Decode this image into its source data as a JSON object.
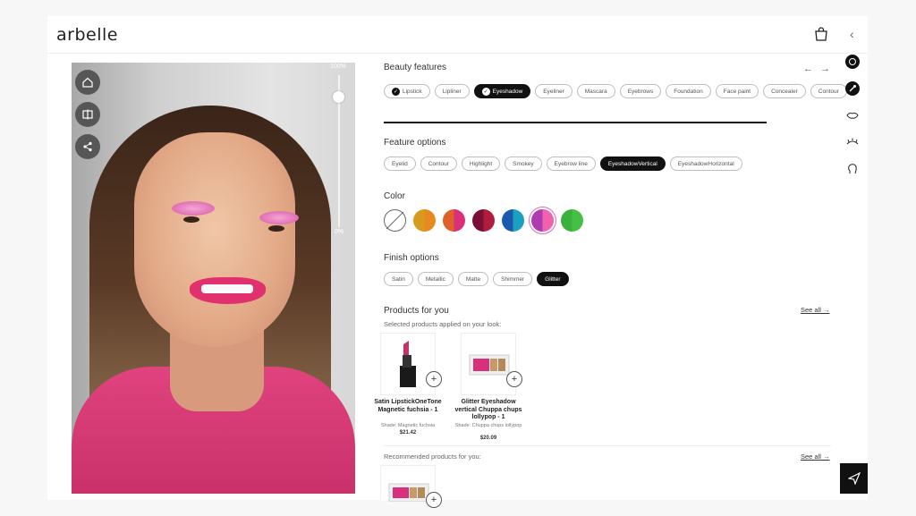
{
  "brand": {
    "logo": "arbelle"
  },
  "camera": {
    "slider_max_label": "100%",
    "slider_min_label": "0%",
    "intensity": 0.86,
    "buttons": [
      "home-icon",
      "compare-icon",
      "share-icon"
    ]
  },
  "beauty_features": {
    "title": "Beauty features",
    "items": [
      {
        "label": "Lipstick",
        "checked": true,
        "active": false
      },
      {
        "label": "Lipliner",
        "checked": false,
        "active": false
      },
      {
        "label": "Eyeshadow",
        "checked": true,
        "active": true
      },
      {
        "label": "Eyeliner",
        "checked": false,
        "active": false
      },
      {
        "label": "Mascara",
        "checked": false,
        "active": false
      },
      {
        "label": "Eyebrows",
        "checked": false,
        "active": false
      },
      {
        "label": "Foundation",
        "checked": false,
        "active": false
      },
      {
        "label": "Face paint",
        "checked": false,
        "active": false
      },
      {
        "label": "Concealer",
        "checked": false,
        "active": false
      },
      {
        "label": "Contour",
        "checked": false,
        "active": false
      }
    ]
  },
  "feature_options": {
    "title": "Feature options",
    "items": [
      {
        "label": "Eyelid",
        "active": false
      },
      {
        "label": "Contour",
        "active": false
      },
      {
        "label": "Highlight",
        "active": false
      },
      {
        "label": "Smokey",
        "active": false
      },
      {
        "label": "Eyebrow line",
        "active": false
      },
      {
        "label": "EyeshadowVertical",
        "active": true
      },
      {
        "label": "EyeshadowHorizontal",
        "active": false
      }
    ]
  },
  "color": {
    "title": "Color",
    "swatches": [
      {
        "name": "none",
        "left": "#ffffff",
        "right": "#ffffff"
      },
      {
        "name": "gold-orange",
        "left": "#d89a1e",
        "right": "#e68a20"
      },
      {
        "name": "orange-pink",
        "left": "#e0602a",
        "right": "#d8307a"
      },
      {
        "name": "plum-red",
        "left": "#7a1036",
        "right": "#b01c3c"
      },
      {
        "name": "blue-teal",
        "left": "#1c5ab0",
        "right": "#1ca0c0"
      },
      {
        "name": "magenta-pink",
        "left": "#b03ab0",
        "right": "#f062b0",
        "selected": true
      },
      {
        "name": "green",
        "left": "#3cb03c",
        "right": "#44c044"
      }
    ]
  },
  "finish_options": {
    "title": "Finish options",
    "items": [
      {
        "label": "Satin",
        "active": false
      },
      {
        "label": "Metallic",
        "active": false
      },
      {
        "label": "Matte",
        "active": false
      },
      {
        "label": "Shimmer",
        "active": false
      },
      {
        "label": "Glitter",
        "active": true
      }
    ]
  },
  "products": {
    "title": "Products for you",
    "see_all": "See all",
    "applied_label": "Selected products applied on your look:",
    "items": [
      {
        "name": "Satin LipstickOneTone Magnetic fuchsia - 1",
        "shade": "Shade: Magnetic fuchsia",
        "price": "$21.42"
      },
      {
        "name": "Glitter Eyeshadow vertical Chuppa chups lollypop - 1",
        "shade": "Shade: Chuppa chups lollypop",
        "price": "$20.09"
      }
    ],
    "recommended_label": "Recommended products for you:",
    "recommended_see_all": "See all"
  }
}
